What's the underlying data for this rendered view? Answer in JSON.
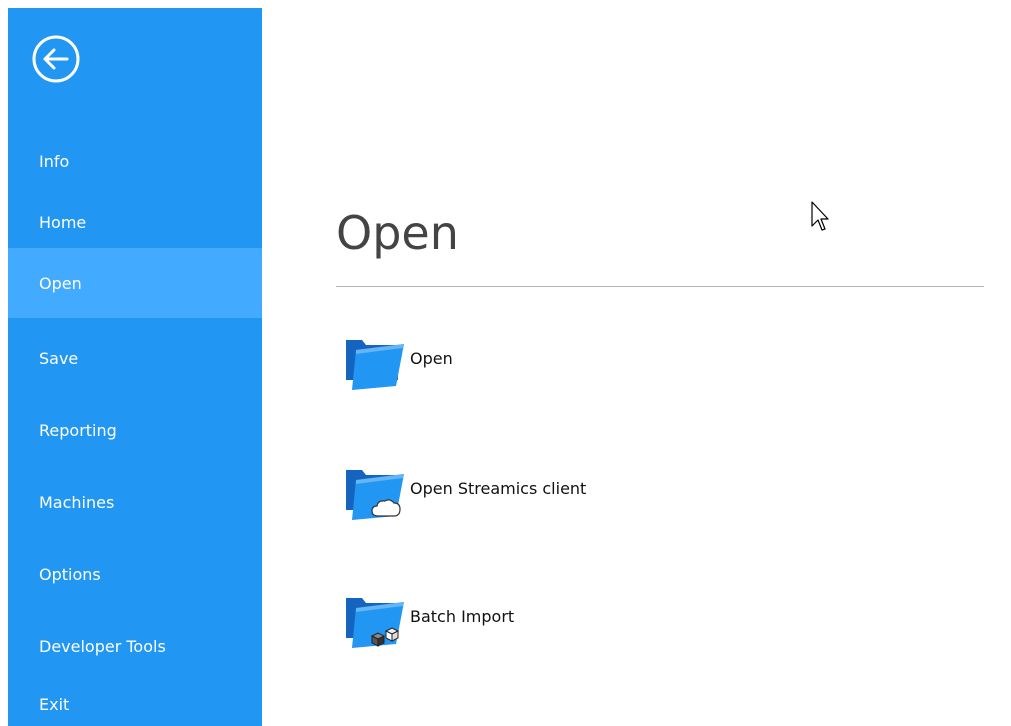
{
  "sidebar": {
    "back_label": "",
    "items": [
      {
        "label": "Info",
        "active": false
      },
      {
        "label": "Home",
        "active": false
      },
      {
        "label": "Open",
        "active": true
      },
      {
        "label": "Save",
        "active": false
      },
      {
        "label": "Reporting",
        "active": false
      },
      {
        "label": "Machines",
        "active": false
      },
      {
        "label": "Options",
        "active": false
      },
      {
        "label": "Developer Tools",
        "active": false
      },
      {
        "label": "Exit",
        "active": false
      }
    ]
  },
  "main": {
    "title": "Open",
    "actions": [
      {
        "label": "Open",
        "icon": "folder-icon"
      },
      {
        "label": "Open Streamics client",
        "icon": "folder-cloud-icon"
      },
      {
        "label": "Batch Import",
        "icon": "folder-cubes-icon"
      }
    ]
  },
  "colors": {
    "sidebar_bg": "#2196f3",
    "sidebar_active_bg": "#42aaff",
    "folder_blue": "#1e88e5",
    "title_color": "#444444"
  }
}
